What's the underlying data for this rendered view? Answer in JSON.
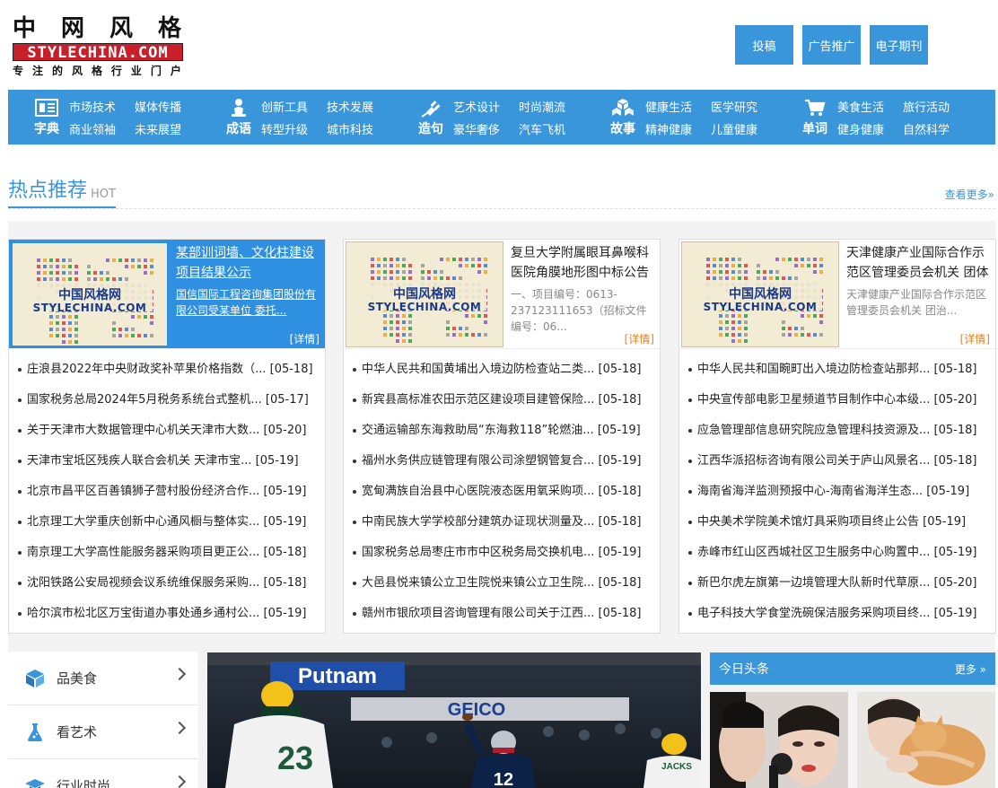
{
  "logo": {
    "cn": [
      "中",
      "网",
      "风",
      "格"
    ],
    "en": "STYLECHINA.COM",
    "sub": [
      "专",
      "注",
      "的",
      "风",
      "格",
      "行",
      "业",
      "门",
      "户"
    ]
  },
  "top_buttons": [
    "投稿",
    "广告推广",
    "电子期刊"
  ],
  "nav": [
    {
      "name": "字典",
      "icon": "dictionary-icon",
      "links": [
        "市场技术",
        "媒体传播",
        "商业领袖",
        "未来展望"
      ]
    },
    {
      "name": "成语",
      "icon": "person-icon",
      "links": [
        "创新工具",
        "技术发展",
        "转型升级",
        "城市科技"
      ]
    },
    {
      "name": "造句",
      "icon": "plug-icon",
      "links": [
        "艺术设计",
        "时尚潮流",
        "豪华奢侈",
        "汽车飞机"
      ]
    },
    {
      "name": "故事",
      "icon": "cubes-icon",
      "links": [
        "健康生活",
        "医学研究",
        "精神健康",
        "儿童健康"
      ]
    },
    {
      "name": "单词",
      "icon": "cart-icon",
      "links": [
        "美食生活",
        "旅行活动",
        "健身健康",
        "自然科学"
      ]
    }
  ],
  "hot": {
    "title": "热点推荐",
    "sub": "HOT",
    "more": "查看更多»"
  },
  "panels": [
    {
      "thumb_text1": "中国风格网",
      "thumb_text2": "STYLECHINA.COM",
      "title": "某部训词墙、文化柱建设项目结果公示",
      "desc": "国信国际工程咨询集团股份有限公司受某单位 委托...",
      "more": "[详情]",
      "items": [
        {
          "text": "庄浪县2022年中央财政奖补苹果价格指数（...",
          "date": "[05-18]"
        },
        {
          "text": "国家税务总局2024年5月税务系统台式整机...",
          "date": "[05-17]"
        },
        {
          "text": "关于天津市大数据管理中心机关天津市大数...",
          "date": "[05-20]"
        },
        {
          "text": "天津市宝坻区残疾人联合会机关 天津市宝...",
          "date": "[05-19]"
        },
        {
          "text": "北京市昌平区百善镇狮子营村股份经济合作...",
          "date": "[05-19]"
        },
        {
          "text": "北京理工大学重庆创新中心通风橱与整体实...",
          "date": "[05-19]"
        },
        {
          "text": "南京理工大学高性能服务器采购项目更正公...",
          "date": "[05-18]"
        },
        {
          "text": "沈阳铁路公安局视频会议系统维保服务采购...",
          "date": "[05-18]"
        },
        {
          "text": "哈尔滨市松北区万宝街道办事处通乡通村公...",
          "date": "[05-19]"
        }
      ]
    },
    {
      "thumb_text1": "中国风格网",
      "thumb_text2": "STYLECHINA.COM",
      "title": "复旦大学附属眼耳鼻喉科医院角膜地形图中标公告",
      "desc": "一、项目编号：0613-237123111653（招标文件编号：06...",
      "more": "[详情]",
      "items": [
        {
          "text": "中华人民共和国黄埔出入境边防检查站二类...",
          "date": "[05-18]"
        },
        {
          "text": "新宾县高标准农田示范区建设项目建管保险...",
          "date": "[05-18]"
        },
        {
          "text": "交通运输部东海救助局“东海救118”轮燃油...",
          "date": "[05-19]"
        },
        {
          "text": "福州水务供应链管理有限公司涂塑钢管复合...",
          "date": "[05-19]"
        },
        {
          "text": "宽甸满族自治县中心医院液态医用氧采购项...",
          "date": "[05-18]"
        },
        {
          "text": "中南民族大学学校部分建筑办证现状测量及...",
          "date": "[05-18]"
        },
        {
          "text": "国家税务总局枣庄市市中区税务局交换机电...",
          "date": "[05-19]"
        },
        {
          "text": "大邑县悦来镇公立卫生院悦来镇公立卫生院...",
          "date": "[05-18]"
        },
        {
          "text": "赣州市银欣项目咨询管理有限公司关于江西...",
          "date": "[05-18]"
        }
      ]
    },
    {
      "thumb_text1": "中国风格网",
      "thumb_text2": "STYLECHINA.COM",
      "title": "天津健康产业国际合作示范区管理委员会机关 团体",
      "desc": "天津健康产业国际合作示范区管理委员会机关 团治...",
      "more": "[详情]",
      "items": [
        {
          "text": "中华人民共和国畹町出入境边防检查站那邦...",
          "date": "[05-18]"
        },
        {
          "text": "中央宣传部电影卫星频道节目制作中心本级...",
          "date": "[05-20]"
        },
        {
          "text": "应急管理部信息研究院应急管理科技资源及...",
          "date": "[05-18]"
        },
        {
          "text": "江西华派招标咨询有限公司关于庐山风景名...",
          "date": "[05-18]"
        },
        {
          "text": "海南省海洋监测预报中心-海南省海洋生态...",
          "date": "[05-19]"
        },
        {
          "text": "中央美术学院美术馆灯具采购项目终止公告",
          "date": "[05-19]"
        },
        {
          "text": "赤峰市红山区西城社区卫生服务中心购置中...",
          "date": "[05-19]"
        },
        {
          "text": "新巴尔虎左旗第一边境管理大队新时代草原...",
          "date": "[05-20]"
        },
        {
          "text": "电子科技大学食堂洗碗保洁服务采购项目终...",
          "date": "[05-19]"
        }
      ]
    }
  ],
  "categories": [
    {
      "label": "品美食",
      "icon": "cube-icon"
    },
    {
      "label": "看艺术",
      "icon": "flask-icon"
    },
    {
      "label": "行业时尚",
      "icon": "graduation-cap-icon"
    }
  ],
  "photo": {
    "banner1": "Putnam",
    "banner2": "GEICO",
    "jersey1": "23",
    "jersey2": "12",
    "jersey3": "JACKS"
  },
  "headlines": {
    "title": "今日头条",
    "more": "更多 »"
  },
  "colors": {
    "accent": "#3a96da",
    "detail": "#e7821f",
    "active_panel": "#2f8fe0",
    "logo_red": "#c8202a"
  }
}
